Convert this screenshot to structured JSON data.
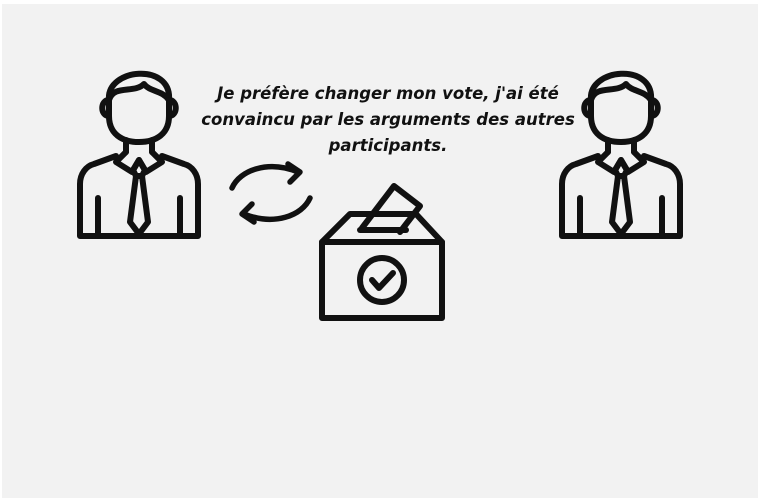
{
  "speech": {
    "text": "Je préfère changer mon vote, j'ai été convaincu par les arguments des autres participants."
  },
  "icons": {
    "left_person": "businessman-icon",
    "right_person": "businessman-icon",
    "swap": "swap-arrows-icon",
    "ballot": "ballot-box-icon",
    "check": "checkmark-circle-icon"
  },
  "colors": {
    "background": "#f2f2f2",
    "ink": "#111111"
  }
}
